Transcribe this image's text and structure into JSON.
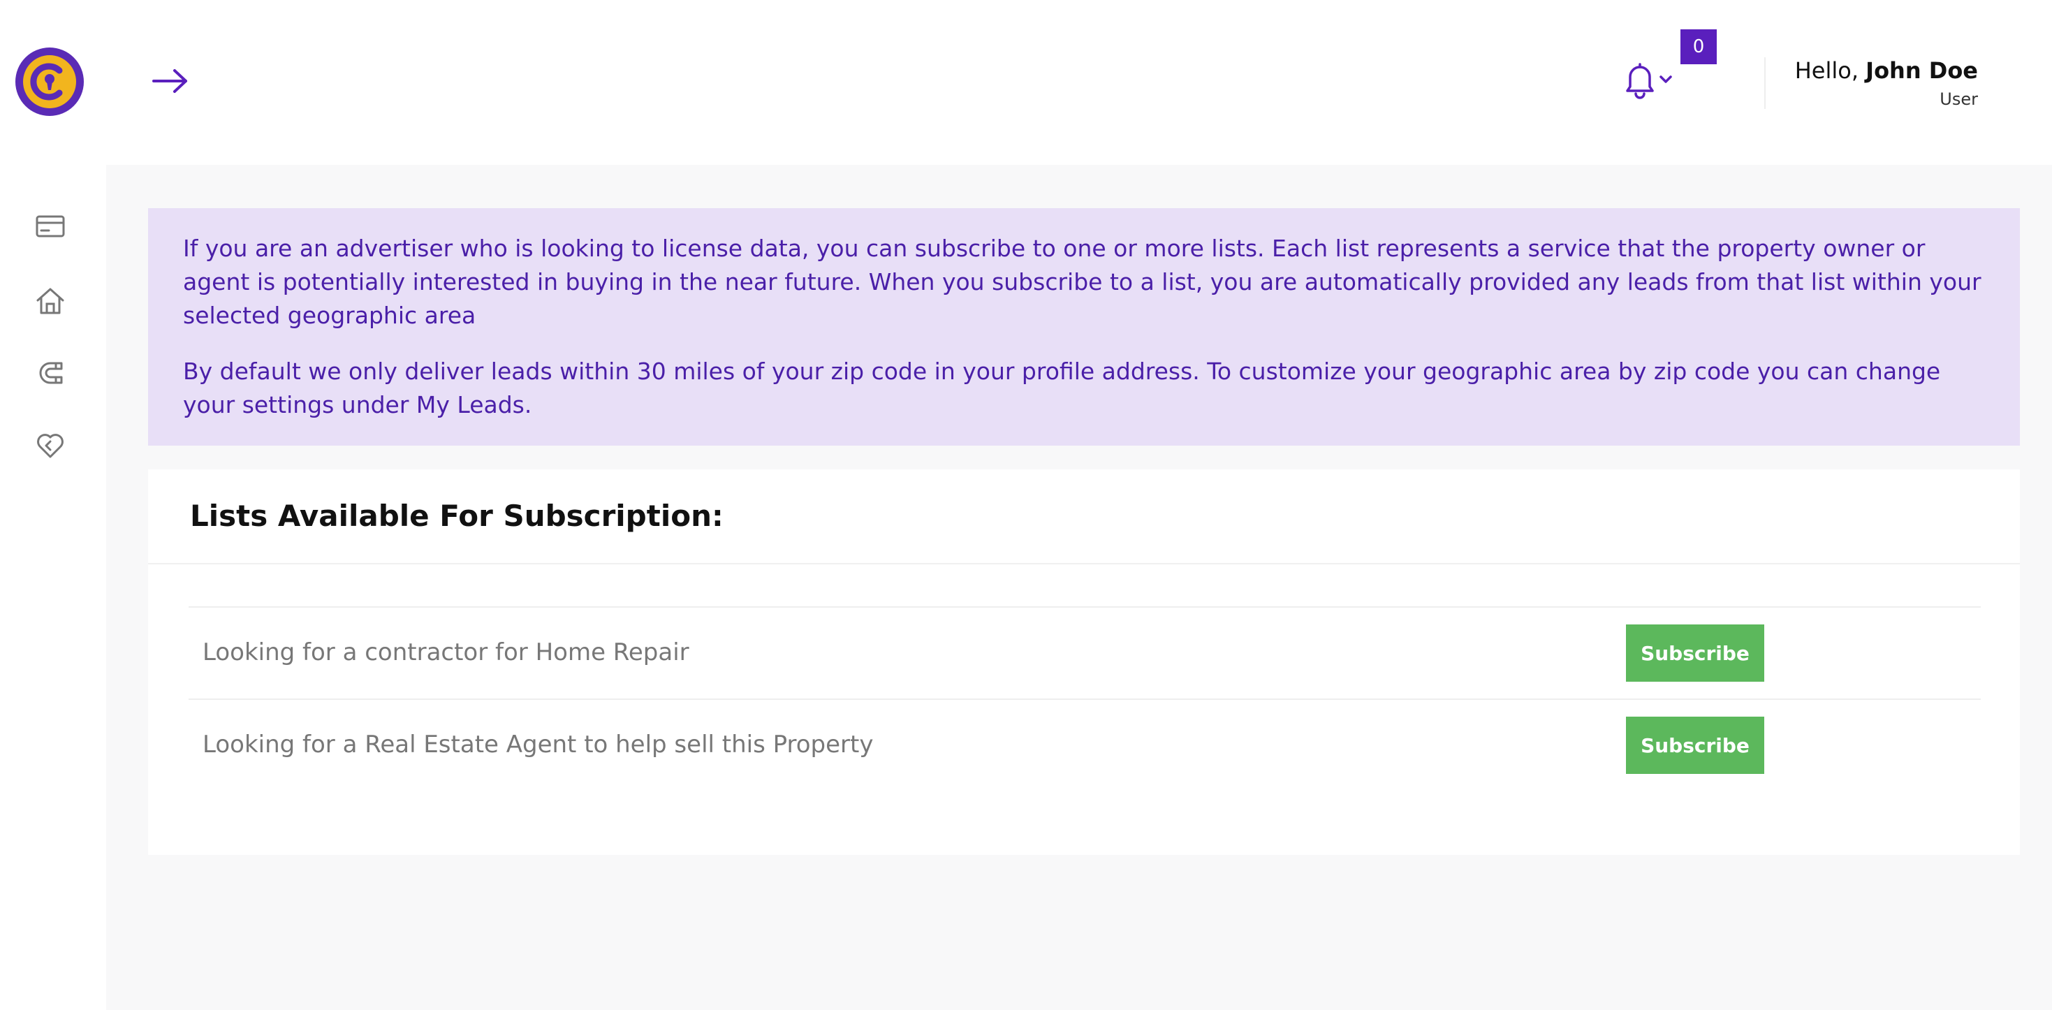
{
  "header": {
    "notification_count": "0",
    "greeting_prefix": "Hello, ",
    "user_name": "John Doe",
    "user_role": "User"
  },
  "icons": {
    "logo": "keyhole-logo-icon",
    "toggle": "arrow-right-icon",
    "bell": "bell-icon",
    "dropdown": "chevron-down-icon",
    "sidebar": [
      "credit-card-icon",
      "home-icon",
      "magnet-icon",
      "heart-icon"
    ]
  },
  "colors": {
    "brand_purple": "#5a1fbd",
    "logo_yellow": "#f2b51e",
    "notice_bg": "#e8dff7",
    "notice_text": "#4a1fa8",
    "subscribe_green": "#5cb85c"
  },
  "notice": {
    "paragraph1": "If you are an advertiser who is looking to license data, you can subscribe to one or more lists. Each list represents a service that the property owner or agent is potentially interested in buying in the near future. When you subscribe to a list, you are automatically provided any leads from that list within your selected geographic area",
    "paragraph2": "By default we only deliver leads within 30 miles of your zip code in your profile address. To customize your geographic area by zip code you can change your settings under My Leads."
  },
  "lists": {
    "title": "Lists Available For Subscription:",
    "items": [
      {
        "label": "Looking for a contractor for Home Repair",
        "button": "Subscribe"
      },
      {
        "label": "Looking for a Real Estate Agent to help sell this Property",
        "button": "Subscribe"
      }
    ]
  }
}
